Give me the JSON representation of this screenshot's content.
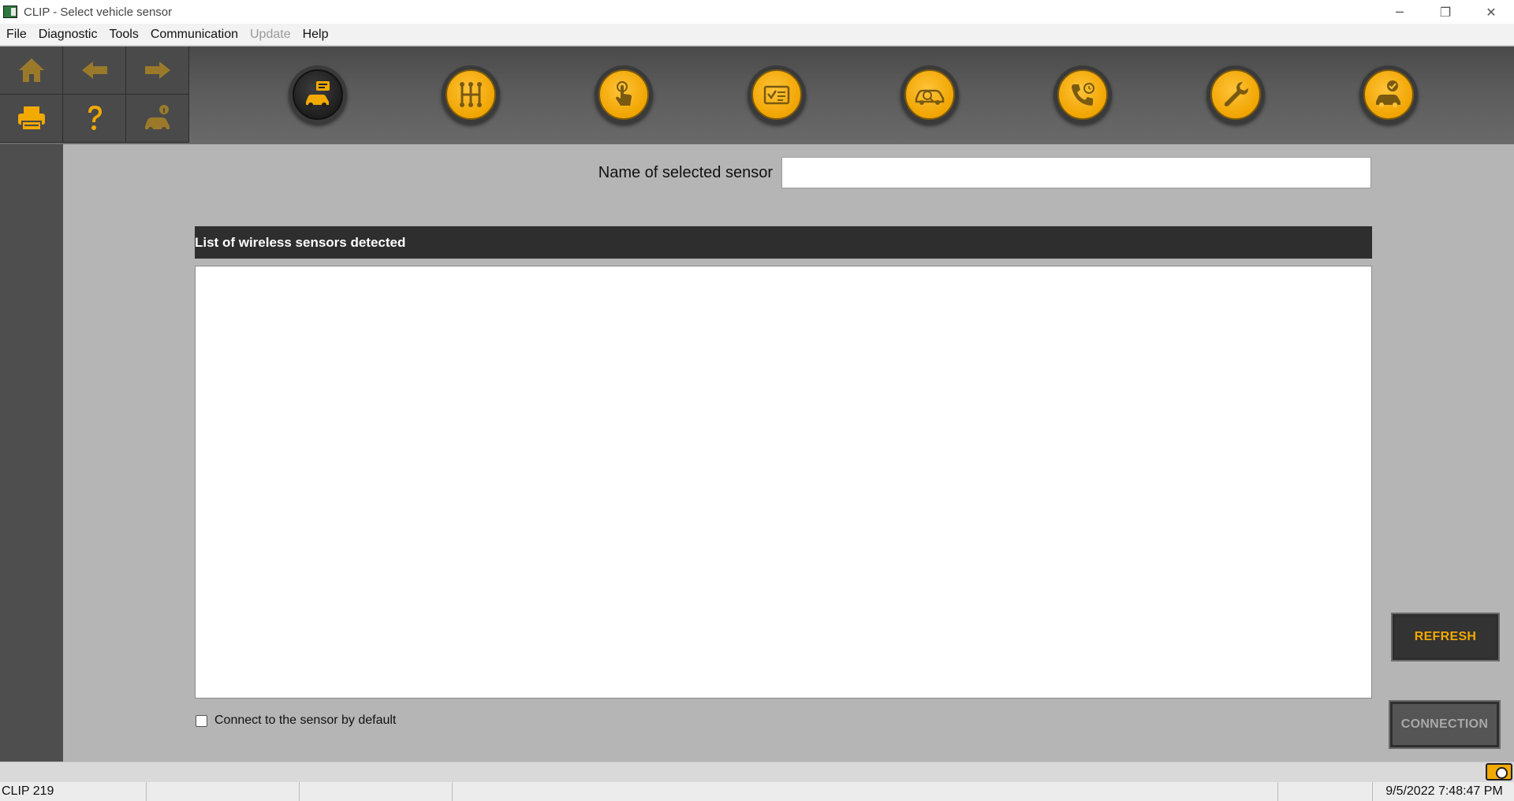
{
  "window": {
    "title": "CLIP - Select vehicle sensor",
    "minimize_glyph": "─",
    "maximize_glyph": "❐",
    "close_glyph": "✕"
  },
  "menu": {
    "items": [
      {
        "label": "File",
        "enabled": true
      },
      {
        "label": "Diagnostic",
        "enabled": true
      },
      {
        "label": "Tools",
        "enabled": true
      },
      {
        "label": "Communication",
        "enabled": true
      },
      {
        "label": "Update",
        "enabled": false
      },
      {
        "label": "Help",
        "enabled": true
      }
    ]
  },
  "toolbar": {
    "nav_icons": [
      "home-icon",
      "back-arrow-icon",
      "forward-arrow-icon",
      "printer-icon",
      "help-icon",
      "vehicle-info-icon"
    ],
    "tool_icons": [
      "vehicle-sensor-icon",
      "gearbox-icon",
      "touch-icon",
      "checklist-icon",
      "vehicle-search-icon",
      "phone-support-icon",
      "wrench-icon",
      "vehicle-check-icon"
    ],
    "accent_color": "#f2a900"
  },
  "form": {
    "sensor_label": "Name of selected sensor",
    "sensor_value": ""
  },
  "list": {
    "header": "List of wireless sensors detected",
    "items": []
  },
  "options": {
    "connect_default_label": "Connect to the sensor by default",
    "connect_default_checked": false
  },
  "buttons": {
    "refresh": "REFRESH",
    "connection": "CONNECTION"
  },
  "status": {
    "version": "CLIP 219",
    "datetime": "9/5/2022 7:48:47 PM"
  }
}
